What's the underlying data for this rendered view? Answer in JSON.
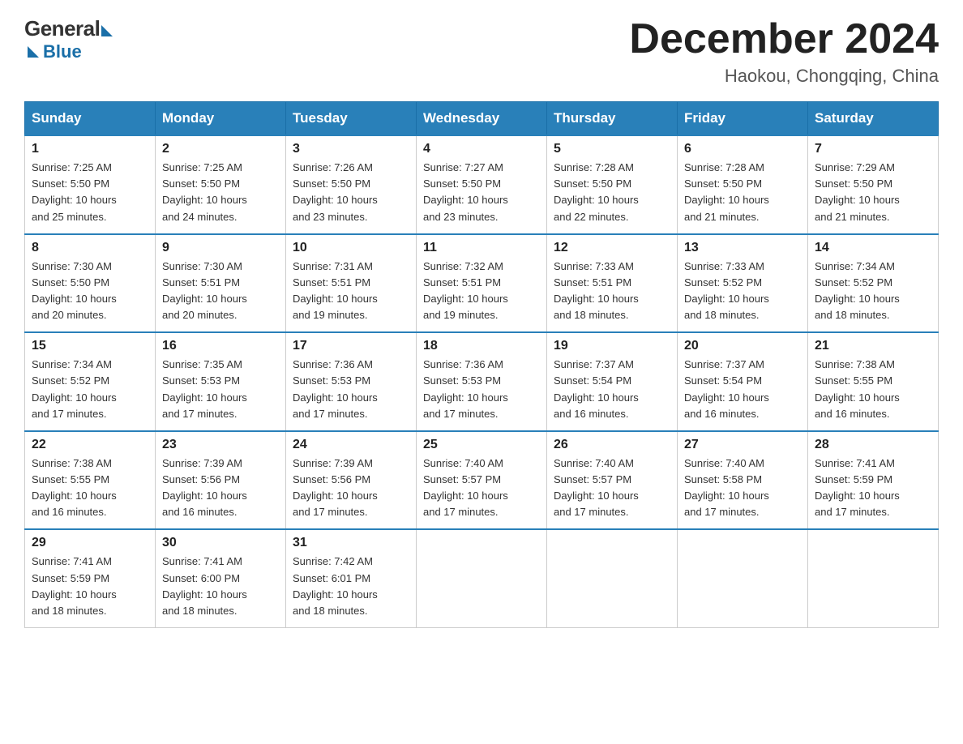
{
  "logo": {
    "general": "General",
    "blue": "Blue"
  },
  "header": {
    "title": "December 2024",
    "location": "Haokou, Chongqing, China"
  },
  "days_of_week": [
    "Sunday",
    "Monday",
    "Tuesday",
    "Wednesday",
    "Thursday",
    "Friday",
    "Saturday"
  ],
  "weeks": [
    [
      {
        "day": "1",
        "sunrise": "7:25 AM",
        "sunset": "5:50 PM",
        "daylight": "10 hours and 25 minutes."
      },
      {
        "day": "2",
        "sunrise": "7:25 AM",
        "sunset": "5:50 PM",
        "daylight": "10 hours and 24 minutes."
      },
      {
        "day": "3",
        "sunrise": "7:26 AM",
        "sunset": "5:50 PM",
        "daylight": "10 hours and 23 minutes."
      },
      {
        "day": "4",
        "sunrise": "7:27 AM",
        "sunset": "5:50 PM",
        "daylight": "10 hours and 23 minutes."
      },
      {
        "day": "5",
        "sunrise": "7:28 AM",
        "sunset": "5:50 PM",
        "daylight": "10 hours and 22 minutes."
      },
      {
        "day": "6",
        "sunrise": "7:28 AM",
        "sunset": "5:50 PM",
        "daylight": "10 hours and 21 minutes."
      },
      {
        "day": "7",
        "sunrise": "7:29 AM",
        "sunset": "5:50 PM",
        "daylight": "10 hours and 21 minutes."
      }
    ],
    [
      {
        "day": "8",
        "sunrise": "7:30 AM",
        "sunset": "5:50 PM",
        "daylight": "10 hours and 20 minutes."
      },
      {
        "day": "9",
        "sunrise": "7:30 AM",
        "sunset": "5:51 PM",
        "daylight": "10 hours and 20 minutes."
      },
      {
        "day": "10",
        "sunrise": "7:31 AM",
        "sunset": "5:51 PM",
        "daylight": "10 hours and 19 minutes."
      },
      {
        "day": "11",
        "sunrise": "7:32 AM",
        "sunset": "5:51 PM",
        "daylight": "10 hours and 19 minutes."
      },
      {
        "day": "12",
        "sunrise": "7:33 AM",
        "sunset": "5:51 PM",
        "daylight": "10 hours and 18 minutes."
      },
      {
        "day": "13",
        "sunrise": "7:33 AM",
        "sunset": "5:52 PM",
        "daylight": "10 hours and 18 minutes."
      },
      {
        "day": "14",
        "sunrise": "7:34 AM",
        "sunset": "5:52 PM",
        "daylight": "10 hours and 18 minutes."
      }
    ],
    [
      {
        "day": "15",
        "sunrise": "7:34 AM",
        "sunset": "5:52 PM",
        "daylight": "10 hours and 17 minutes."
      },
      {
        "day": "16",
        "sunrise": "7:35 AM",
        "sunset": "5:53 PM",
        "daylight": "10 hours and 17 minutes."
      },
      {
        "day": "17",
        "sunrise": "7:36 AM",
        "sunset": "5:53 PM",
        "daylight": "10 hours and 17 minutes."
      },
      {
        "day": "18",
        "sunrise": "7:36 AM",
        "sunset": "5:53 PM",
        "daylight": "10 hours and 17 minutes."
      },
      {
        "day": "19",
        "sunrise": "7:37 AM",
        "sunset": "5:54 PM",
        "daylight": "10 hours and 16 minutes."
      },
      {
        "day": "20",
        "sunrise": "7:37 AM",
        "sunset": "5:54 PM",
        "daylight": "10 hours and 16 minutes."
      },
      {
        "day": "21",
        "sunrise": "7:38 AM",
        "sunset": "5:55 PM",
        "daylight": "10 hours and 16 minutes."
      }
    ],
    [
      {
        "day": "22",
        "sunrise": "7:38 AM",
        "sunset": "5:55 PM",
        "daylight": "10 hours and 16 minutes."
      },
      {
        "day": "23",
        "sunrise": "7:39 AM",
        "sunset": "5:56 PM",
        "daylight": "10 hours and 16 minutes."
      },
      {
        "day": "24",
        "sunrise": "7:39 AM",
        "sunset": "5:56 PM",
        "daylight": "10 hours and 17 minutes."
      },
      {
        "day": "25",
        "sunrise": "7:40 AM",
        "sunset": "5:57 PM",
        "daylight": "10 hours and 17 minutes."
      },
      {
        "day": "26",
        "sunrise": "7:40 AM",
        "sunset": "5:57 PM",
        "daylight": "10 hours and 17 minutes."
      },
      {
        "day": "27",
        "sunrise": "7:40 AM",
        "sunset": "5:58 PM",
        "daylight": "10 hours and 17 minutes."
      },
      {
        "day": "28",
        "sunrise": "7:41 AM",
        "sunset": "5:59 PM",
        "daylight": "10 hours and 17 minutes."
      }
    ],
    [
      {
        "day": "29",
        "sunrise": "7:41 AM",
        "sunset": "5:59 PM",
        "daylight": "10 hours and 18 minutes."
      },
      {
        "day": "30",
        "sunrise": "7:41 AM",
        "sunset": "6:00 PM",
        "daylight": "10 hours and 18 minutes."
      },
      {
        "day": "31",
        "sunrise": "7:42 AM",
        "sunset": "6:01 PM",
        "daylight": "10 hours and 18 minutes."
      },
      null,
      null,
      null,
      null
    ]
  ],
  "labels": {
    "sunrise": "Sunrise:",
    "sunset": "Sunset:",
    "daylight": "Daylight:"
  }
}
